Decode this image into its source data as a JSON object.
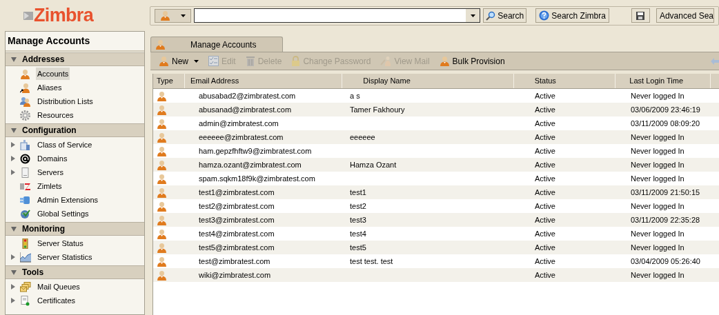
{
  "logo": {
    "text": "Zimbra"
  },
  "search_bar": {
    "search_button": "Search",
    "search_zimbra_button": "Search Zimbra",
    "advanced_button": "Advanced Sea"
  },
  "sidebar": {
    "title": "Manage Accounts",
    "sections": [
      {
        "label": "Addresses",
        "expanded": true,
        "items": [
          {
            "label": "Accounts",
            "selected": true,
            "has_children": false
          },
          {
            "label": "Aliases",
            "selected": false,
            "has_children": false
          },
          {
            "label": "Distribution Lists",
            "selected": false,
            "has_children": false
          },
          {
            "label": "Resources",
            "selected": false,
            "has_children": false
          }
        ]
      },
      {
        "label": "Configuration",
        "expanded": true,
        "items": [
          {
            "label": "Class of Service",
            "selected": false,
            "has_children": true
          },
          {
            "label": "Domains",
            "selected": false,
            "has_children": true
          },
          {
            "label": "Servers",
            "selected": false,
            "has_children": true
          },
          {
            "label": "Zimlets",
            "selected": false,
            "has_children": false
          },
          {
            "label": "Admin Extensions",
            "selected": false,
            "has_children": false
          },
          {
            "label": "Global Settings",
            "selected": false,
            "has_children": false
          }
        ]
      },
      {
        "label": "Monitoring",
        "expanded": true,
        "items": [
          {
            "label": "Server Status",
            "selected": false,
            "has_children": false
          },
          {
            "label": "Server Statistics",
            "selected": false,
            "has_children": true
          }
        ]
      },
      {
        "label": "Tools",
        "expanded": true,
        "items": [
          {
            "label": "Mail Queues",
            "selected": false,
            "has_children": true
          },
          {
            "label": "Certificates",
            "selected": false,
            "has_children": true
          }
        ]
      }
    ]
  },
  "tabs": [
    {
      "label": "Manage Accounts",
      "selected": true
    }
  ],
  "toolbar": [
    {
      "label": "New",
      "disabled": false,
      "dropdown": true
    },
    {
      "label": "Edit",
      "disabled": true,
      "dropdown": false
    },
    {
      "label": "Delete",
      "disabled": true,
      "dropdown": false
    },
    {
      "label": "Change Password",
      "disabled": true,
      "dropdown": false
    },
    {
      "label": "View Mail",
      "disabled": true,
      "dropdown": false
    },
    {
      "label": "Bulk Provision",
      "disabled": false,
      "dropdown": false
    }
  ],
  "table": {
    "columns": [
      "Type",
      "Email Address",
      "Display Name",
      "Status",
      "Last Login Time"
    ],
    "rows": [
      {
        "email": "abusabad2@zimbratest.com",
        "display_name": "a s",
        "status": "Active",
        "last_login": "Never logged In"
      },
      {
        "email": "abusanad@zimbratest.com",
        "display_name": "Tamer Fakhoury",
        "status": "Active",
        "last_login": "03/06/2009 23:46:19"
      },
      {
        "email": "admin@zimbratest.com",
        "status": "Active",
        "last_login": "03/11/2009 08:09:20"
      },
      {
        "email": "eeeeee@zimbratest.com",
        "display_name": "eeeeee",
        "status": "Active",
        "last_login": "Never logged In"
      },
      {
        "email": "ham.gepzfhftw9@zimbratest.com",
        "status": "Active",
        "last_login": "Never logged In"
      },
      {
        "email": "hamza.ozant@zimbratest.com",
        "display_name": "Hamza Ozant",
        "status": "Active",
        "last_login": "Never logged In"
      },
      {
        "email": "spam.sqkm18f9k@zimbratest.com",
        "status": "Active",
        "last_login": "Never logged In"
      },
      {
        "email": "test1@zimbratest.com",
        "display_name": "test1",
        "status": "Active",
        "last_login": "03/11/2009 21:50:15"
      },
      {
        "email": "test2@zimbratest.com",
        "display_name": "test2",
        "status": "Active",
        "last_login": "Never logged In"
      },
      {
        "email": "test3@zimbratest.com",
        "display_name": "test3",
        "status": "Active",
        "last_login": "03/11/2009 22:35:28"
      },
      {
        "email": "test4@zimbratest.com",
        "display_name": "test4",
        "status": "Active",
        "last_login": "Never logged In"
      },
      {
        "email": "test5@zimbratest.com",
        "display_name": "test5",
        "status": "Active",
        "last_login": "Never logged In"
      },
      {
        "email": "test@zimbratest.com",
        "display_name": "test test. test",
        "status": "Active",
        "last_login": "03/04/2009 05:26:40"
      },
      {
        "email": "wiki@zimbratest.com",
        "status": "Active",
        "last_login": "Never logged In"
      }
    ]
  }
}
